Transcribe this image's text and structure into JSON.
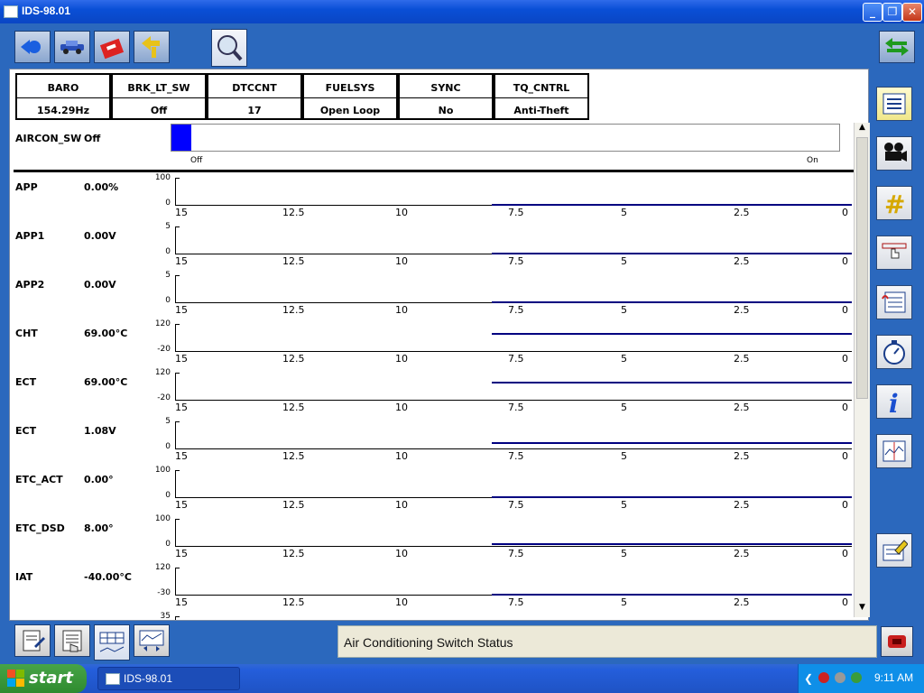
{
  "window": {
    "title": "IDS-98.01"
  },
  "pids": [
    {
      "name": "BARO",
      "value": "154.29Hz"
    },
    {
      "name": "BRK_LT_SW",
      "value": "Off"
    },
    {
      "name": "DTCCNT",
      "value": "17"
    },
    {
      "name": "FUELSYS",
      "value": "Open Loop"
    },
    {
      "name": "SYNC",
      "value": "No"
    },
    {
      "name": "TQ_CNTRL",
      "value": "Anti-Theft"
    }
  ],
  "aircon": {
    "name": "AIRCON_SW",
    "value": "Off",
    "off_label": "Off",
    "on_label": "On",
    "state": 0
  },
  "axis_ticks": [
    "15",
    "12.5",
    "10",
    "7.5",
    "5",
    "2.5",
    "0"
  ],
  "graphs": [
    {
      "name": "APP",
      "value": "0.00%",
      "ymax": "100",
      "ymin": "0",
      "level": 0
    },
    {
      "name": "APP1",
      "value": "0.00V",
      "ymax": "5",
      "ymin": "0",
      "level": 0
    },
    {
      "name": "APP2",
      "value": "0.00V",
      "ymax": "5",
      "ymin": "0",
      "level": 0
    },
    {
      "name": "CHT",
      "value": "69.00°C",
      "ymax": "120",
      "ymin": "-20",
      "level": 0.636
    },
    {
      "name": "ECT",
      "value": "69.00°C",
      "ymax": "120",
      "ymin": "-20",
      "level": 0.636
    },
    {
      "name": "ECT",
      "value": "1.08V",
      "ymax": "5",
      "ymin": "0",
      "level": 0.216
    },
    {
      "name": "ETC_ACT",
      "value": "0.00°",
      "ymax": "100",
      "ymin": "0",
      "level": 0
    },
    {
      "name": "ETC_DSD",
      "value": "8.00°",
      "ymax": "100",
      "ymin": "0",
      "level": 0.08
    },
    {
      "name": "IAT",
      "value": "-40.00°C",
      "ymax": "120",
      "ymin": "-30",
      "level": 0
    }
  ],
  "partial_graph": {
    "ymax": "35"
  },
  "status": {
    "text": "Air Conditioning Switch Status"
  },
  "taskbar": {
    "start_label": "start",
    "task_label": "IDS-98.01",
    "clock": "9:11 AM"
  },
  "colors": {
    "trace": "#000080",
    "aircon_bar": "#0000ff"
  }
}
